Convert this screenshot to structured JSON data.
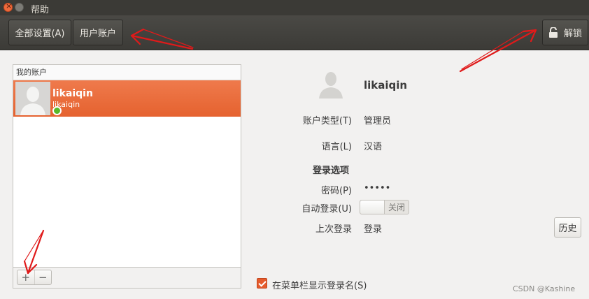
{
  "window": {
    "title": "帮助"
  },
  "toolbar": {
    "all_settings_label": "全部设置(A)",
    "user_accounts_label": "用户账户",
    "unlock_label": "解锁"
  },
  "account_list": {
    "header": "我的账户",
    "accounts": [
      {
        "display_name": "likaiqin",
        "username": "likaiqin",
        "online": true
      }
    ]
  },
  "details": {
    "name": "likaiqin",
    "account_type_label": "账户类型(T)",
    "account_type_value": "管理员",
    "language_label": "语言(L)",
    "language_value": "汉语",
    "login_options_heading": "登录选项",
    "password_label": "密码(P)",
    "password_value": "•••••",
    "auto_login_label": "自动登录(U)",
    "auto_login_state": "关闭",
    "last_login_label": "上次登录",
    "last_login_value": "登录",
    "history_button": "历史"
  },
  "footer": {
    "show_login_name_label": "在菜单栏显示登录名(S)",
    "show_login_name_checked": true
  },
  "watermark": "CSDN @Kashine",
  "colors": {
    "accent": "#e8683a",
    "toolbar": "#43423e",
    "annotation_arrow": "#e01a1a"
  }
}
